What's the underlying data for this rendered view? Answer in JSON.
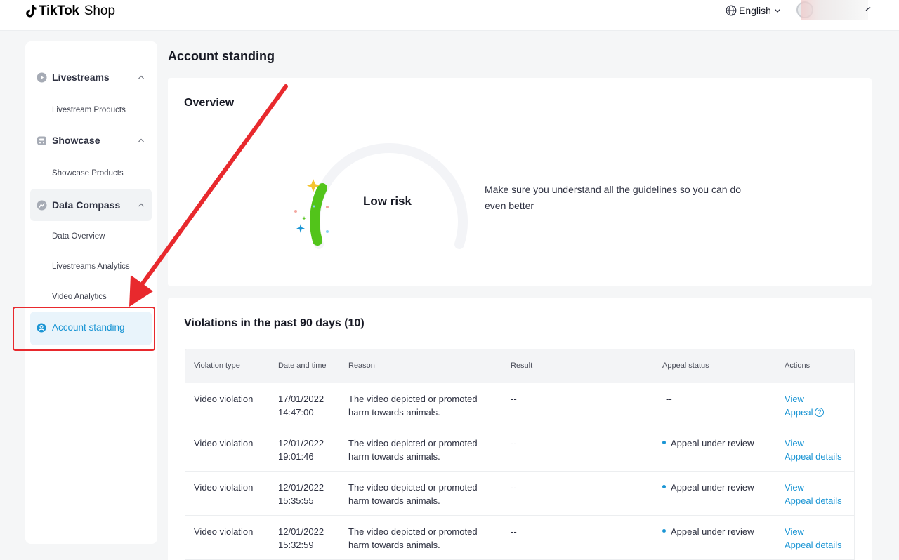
{
  "header": {
    "brand": "TikTok",
    "brand_suffix": "Shop",
    "language": "English"
  },
  "sidebar": {
    "groups": [
      {
        "label": "Livestreams",
        "icon": "play-circle-icon",
        "sub": [
          "Livestream Products"
        ]
      },
      {
        "label": "Showcase",
        "icon": "showcase-icon",
        "sub": [
          "Showcase Products"
        ]
      },
      {
        "label": "Data Compass",
        "icon": "compass-icon",
        "sub": [
          "Data Overview",
          "Livestreams Analytics",
          "Video Analytics"
        ]
      }
    ],
    "active": {
      "label": "Account standing",
      "icon": "user-circle-icon"
    }
  },
  "main": {
    "title": "Account standing",
    "overview": {
      "title": "Overview",
      "risk": "Low risk",
      "message": "Make sure you understand all the guidelines so you can do even better"
    },
    "violations": {
      "title": "Violations in the past 90 days (10)",
      "columns": [
        "Violation type",
        "Date and time",
        "Reason",
        "Result",
        "Appeal status",
        "Actions"
      ],
      "rows": [
        {
          "type": "Video violation",
          "date": "17/01/2022",
          "time": "14:47:00",
          "reason": "The video depicted or promoted harm towards animals.",
          "result": "--",
          "appeal_status": "--",
          "action1": "View",
          "action2": "Appeal",
          "help": "?"
        },
        {
          "type": "Video violation",
          "date": "12/01/2022",
          "time": "19:01:46",
          "reason": "The video depicted or promoted harm towards animals.",
          "result": "--",
          "appeal_status": "Appeal under review",
          "action1": "View",
          "action2": "Appeal details"
        },
        {
          "type": "Video violation",
          "date": "12/01/2022",
          "time": "15:35:55",
          "reason": "The video depicted or promoted harm towards animals.",
          "result": "--",
          "appeal_status": "Appeal under review",
          "action1": "View",
          "action2": "Appeal details"
        },
        {
          "type": "Video violation",
          "date": "12/01/2022",
          "time": "15:32:59",
          "reason": "The video depicted or promoted harm towards animals.",
          "result": "--",
          "appeal_status": "Appeal under review",
          "action1": "View",
          "action2": "Appeal details"
        }
      ]
    }
  },
  "colors": {
    "accent": "#1a95d4",
    "annotation": "#e8292d",
    "gauge_green": "#52c41a"
  }
}
